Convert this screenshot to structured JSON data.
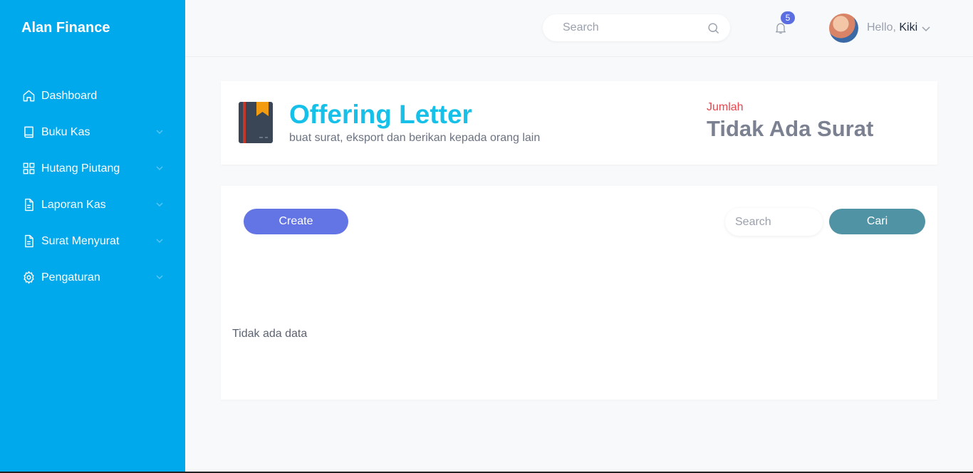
{
  "brand": {
    "name": "Alan Finance"
  },
  "sidebar": {
    "items": [
      {
        "label": "Dashboard",
        "icon": "home-icon",
        "has_children": false
      },
      {
        "label": "Buku Kas",
        "icon": "book-icon",
        "has_children": true
      },
      {
        "label": "Hutang Piutang",
        "icon": "grid-icon",
        "has_children": true
      },
      {
        "label": "Laporan Kas",
        "icon": "document-icon",
        "has_children": true
      },
      {
        "label": "Surat Menyurat",
        "icon": "document-icon",
        "has_children": true
      },
      {
        "label": "Pengaturan",
        "icon": "gear-icon",
        "has_children": true
      }
    ]
  },
  "topbar": {
    "search_placeholder": "Search",
    "notification_count": "5",
    "greeting": "Hello,",
    "username": "Kiki"
  },
  "header": {
    "title": "Offering Letter",
    "subtitle": "buat surat, eksport dan berikan kepada orang lain",
    "count_label": "Jumlah",
    "count_value": "Tidak Ada Surat"
  },
  "content": {
    "create_label": "Create",
    "search_placeholder": "Search",
    "search_button_label": "Cari",
    "empty_message": "Tidak ada data"
  },
  "colors": {
    "sidebar_bg": "#00a8ec",
    "title": "#16c0e8",
    "create_button": "#6374e4",
    "search_button": "#4f93a4",
    "count_label": "#e8464e",
    "badge": "#5b6ee1"
  }
}
